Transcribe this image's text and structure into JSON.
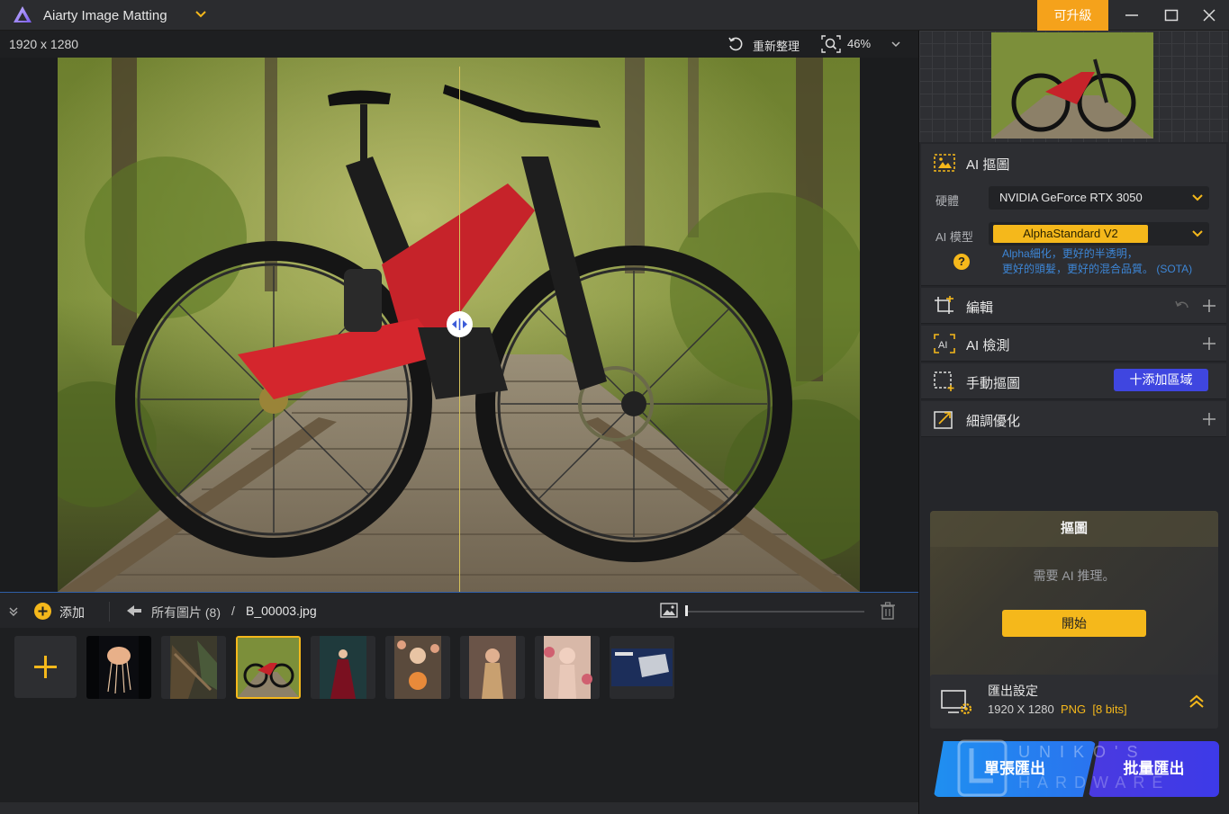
{
  "app": {
    "title": "Aiarty Image Matting",
    "upgrade_label": "可升級"
  },
  "toolbar": {
    "dimensions": "1920 x 1280",
    "reset_label": "重新整理",
    "zoom_level": "46%"
  },
  "strip": {
    "add_label": "添加",
    "crumb_all": "所有圖片 (8)",
    "crumb_separator": "/",
    "crumb_file": "B_00003.jpg",
    "thumbnail_size": 0.0
  },
  "thumbnails": [
    {
      "name": "jellyfish",
      "selected": false
    },
    {
      "name": "forest-debris",
      "selected": false
    },
    {
      "name": "bicycle",
      "selected": true
    },
    {
      "name": "woman-red-dress",
      "selected": false
    },
    {
      "name": "woman-flowers",
      "selected": false
    },
    {
      "name": "woman-gold-dress",
      "selected": false
    },
    {
      "name": "woman-roses",
      "selected": false
    },
    {
      "name": "hardware-box",
      "selected": false
    }
  ],
  "panel": {
    "ai_matting": {
      "title": "AI 摳圖",
      "hardware_label": "硬體",
      "hardware_value": "NVIDIA GeForce RTX 3050",
      "model_label": "AI 模型",
      "model_value": "AlphaStandard  V2",
      "model_desc_line1": "Alpha細化，更好的半透明，",
      "model_desc_line2": "更好的頭髮，更好的混合品質。 (SOTA)"
    },
    "edit_title": "編輯",
    "detect_title": "AI 檢測",
    "manual_title": "手動摳圖",
    "add_region_label": "十添加區域",
    "refine_title": "細調優化",
    "matting_card": {
      "title": "摳圖",
      "note": "需要 AI 推理。",
      "start_label": "開始"
    },
    "export": {
      "title": "匯出設定",
      "size": "1920 X 1280",
      "format": "PNG",
      "bits": "[8 bits]"
    },
    "single_export_label": "單張匯出",
    "batch_export_label": "批量匯出",
    "watermark_line1": "UNIKO'S",
    "watermark_line2": "HARDWARE"
  },
  "colors": {
    "accent": "#f5b81b",
    "upgrade": "#f5a21b",
    "blue_button": "#1f8ff0",
    "purple_button": "#3f46e0"
  }
}
